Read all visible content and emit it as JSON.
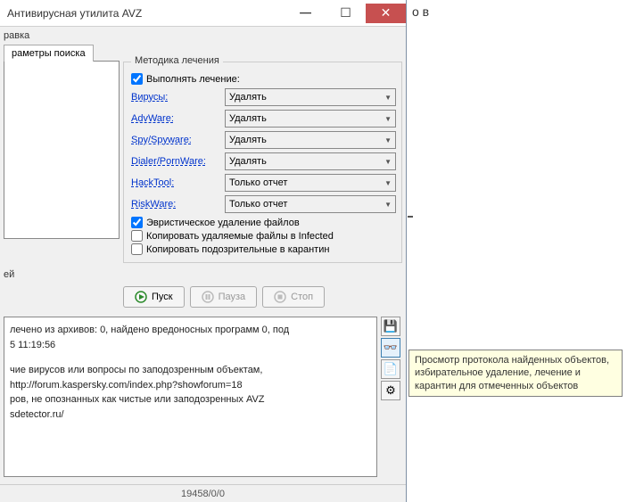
{
  "outer_fragment": "о в",
  "window": {
    "title": "Антивирусная утилита AVZ",
    "menu": "равка",
    "tab_label": "раметры поиска"
  },
  "group": {
    "title": "Методика лечения",
    "do_treat_label": "Выполнять лечение:",
    "do_treat_checked": true,
    "rows": [
      {
        "label": "Вирусы:",
        "value": "Удалять"
      },
      {
        "label": "AdvWare:",
        "value": "Удалять"
      },
      {
        "label": "Spy/Spyware:",
        "value": "Удалять"
      },
      {
        "label": "Dialer/PornWare:",
        "value": "Удалять"
      },
      {
        "label": "HackTool:",
        "value": "Только отчет"
      },
      {
        "label": "RiskWare:",
        "value": "Только отчет"
      }
    ],
    "heur_label": "Эвристическое удаление файлов",
    "heur_checked": true,
    "copy_infected_label": "Копировать удаляемые файлы в  Infected",
    "copy_infected_checked": false,
    "copy_quarantine_label": "Копировать подозрительные в  карантин",
    "copy_quarantine_checked": false
  },
  "buttons": {
    "start": "Пуск",
    "pause": "Пауза",
    "stop": "Стоп"
  },
  "under_left": {
    "l1": "",
    "l2": "ей"
  },
  "log": {
    "line1": "лечено из архивов: 0, найдено вредоносных программ 0, под",
    "line2": "5 11:19:56",
    "line4": "чие вирусов или вопросы по заподозренным объектам,",
    "line5": "http://forum.kaspersky.com/index.php?showforum=18",
    "line6": "ров, не опознанных как чистые или заподозренных AVZ",
    "line7": "sdetector.ru/"
  },
  "status": "19458/0/0",
  "tooltip": "Просмотр протокола найденных объектов, избирательное удаление, лечение и карантин для отмеченных объектов"
}
